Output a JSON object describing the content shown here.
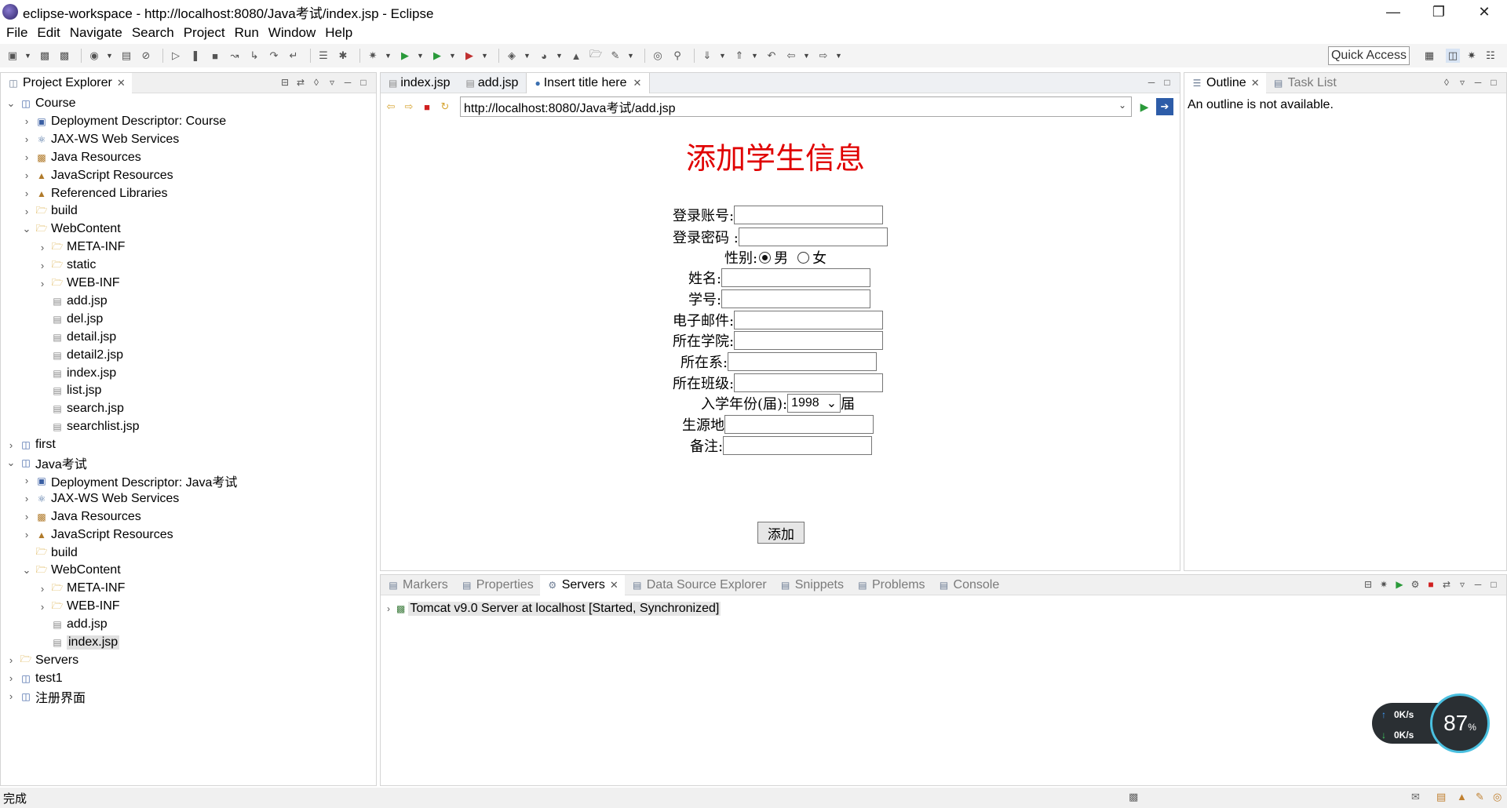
{
  "window": {
    "title": "eclipse-workspace - http://localhost:8080/Java考试/index.jsp - Eclipse"
  },
  "menu": [
    "File",
    "Edit",
    "Navigate",
    "Search",
    "Project",
    "Run",
    "Window",
    "Help"
  ],
  "quick_access": "Quick Access",
  "project_explorer": {
    "tab_label": "Project Explorer",
    "tree": [
      {
        "label": "Course",
        "depth": 0,
        "expanded": true,
        "icon": "project-icon"
      },
      {
        "label": "Deployment Descriptor: Course",
        "depth": 1,
        "expanded": false,
        "icon": "deployment-descriptor-icon"
      },
      {
        "label": "JAX-WS Web Services",
        "depth": 1,
        "expanded": false,
        "icon": "web-services-icon"
      },
      {
        "label": "Java Resources",
        "depth": 1,
        "expanded": false,
        "icon": "java-resources-icon"
      },
      {
        "label": "JavaScript Resources",
        "depth": 1,
        "expanded": false,
        "icon": "javascript-resources-icon"
      },
      {
        "label": "Referenced Libraries",
        "depth": 1,
        "expanded": false,
        "icon": "library-icon"
      },
      {
        "label": "build",
        "depth": 1,
        "expanded": false,
        "icon": "folder-icon"
      },
      {
        "label": "WebContent",
        "depth": 1,
        "expanded": true,
        "icon": "folder-icon"
      },
      {
        "label": "META-INF",
        "depth": 2,
        "expanded": false,
        "icon": "folder-icon"
      },
      {
        "label": "static",
        "depth": 2,
        "expanded": false,
        "icon": "folder-icon"
      },
      {
        "label": "WEB-INF",
        "depth": 2,
        "expanded": false,
        "icon": "folder-icon"
      },
      {
        "label": "add.jsp",
        "depth": 2,
        "leaf": true,
        "icon": "file-icon"
      },
      {
        "label": "del.jsp",
        "depth": 2,
        "leaf": true,
        "icon": "file-icon"
      },
      {
        "label": "detail.jsp",
        "depth": 2,
        "leaf": true,
        "icon": "file-icon"
      },
      {
        "label": "detail2.jsp",
        "depth": 2,
        "leaf": true,
        "icon": "file-icon"
      },
      {
        "label": "index.jsp",
        "depth": 2,
        "leaf": true,
        "icon": "file-icon"
      },
      {
        "label": "list.jsp",
        "depth": 2,
        "leaf": true,
        "icon": "file-icon"
      },
      {
        "label": "search.jsp",
        "depth": 2,
        "leaf": true,
        "icon": "file-icon"
      },
      {
        "label": "searchlist.jsp",
        "depth": 2,
        "leaf": true,
        "icon": "file-icon"
      },
      {
        "label": "first",
        "depth": 0,
        "expanded": false,
        "icon": "project-icon"
      },
      {
        "label": "Java考试",
        "depth": 0,
        "expanded": true,
        "icon": "project-icon"
      },
      {
        "label": "Deployment Descriptor: Java考试",
        "depth": 1,
        "expanded": false,
        "icon": "deployment-descriptor-icon"
      },
      {
        "label": "JAX-WS Web Services",
        "depth": 1,
        "expanded": false,
        "icon": "web-services-icon"
      },
      {
        "label": "Java Resources",
        "depth": 1,
        "expanded": false,
        "icon": "java-resources-icon"
      },
      {
        "label": "JavaScript Resources",
        "depth": 1,
        "expanded": false,
        "icon": "javascript-resources-icon"
      },
      {
        "label": "build",
        "depth": 1,
        "leaf": true,
        "icon": "folder-icon"
      },
      {
        "label": "WebContent",
        "depth": 1,
        "expanded": true,
        "icon": "folder-icon"
      },
      {
        "label": "META-INF",
        "depth": 2,
        "expanded": false,
        "icon": "folder-icon"
      },
      {
        "label": "WEB-INF",
        "depth": 2,
        "expanded": false,
        "icon": "folder-icon"
      },
      {
        "label": "add.jsp",
        "depth": 2,
        "leaf": true,
        "icon": "file-icon"
      },
      {
        "label": "index.jsp",
        "depth": 2,
        "leaf": true,
        "icon": "file-icon",
        "selected": true
      },
      {
        "label": "Servers",
        "depth": 0,
        "expanded": false,
        "icon": "folder-icon"
      },
      {
        "label": "test1",
        "depth": 0,
        "expanded": false,
        "icon": "project-icon"
      },
      {
        "label": "注册界面",
        "depth": 0,
        "expanded": false,
        "icon": "project-icon"
      }
    ]
  },
  "editor": {
    "tabs": [
      {
        "label": "index.jsp",
        "active": false
      },
      {
        "label": "add.jsp",
        "active": false
      },
      {
        "label": "Insert title here",
        "active": true
      }
    ],
    "url": "http://localhost:8080/Java考试/add.jsp"
  },
  "form": {
    "title": "添加学生信息",
    "account_label": "登录账号:",
    "password_label": "登录密码 :",
    "gender_label": "性别:",
    "gender_male": "男",
    "gender_female": "女",
    "gender_selected": "男",
    "name_label": "姓名:",
    "student_id_label": "学号:",
    "email_label": "电子邮件:",
    "college_label": "所在学院:",
    "department_label": "所在系:",
    "class_label": "所在班级:",
    "enroll_year_label": "入学年份(届):",
    "enroll_year_value": "1998",
    "enroll_year_suffix": "届",
    "origin_label": "生源地",
    "remark_label": "备注:",
    "submit_label": "添加"
  },
  "outline": {
    "tabs": [
      {
        "label": "Outline",
        "active": true
      },
      {
        "label": "Task List",
        "active": false
      }
    ],
    "message": "An outline is not available."
  },
  "bottom_panel": {
    "tabs": [
      {
        "label": "Markers",
        "active": false
      },
      {
        "label": "Properties",
        "active": false
      },
      {
        "label": "Servers",
        "active": true
      },
      {
        "label": "Data Source Explorer",
        "active": false
      },
      {
        "label": "Snippets",
        "active": false
      },
      {
        "label": "Problems",
        "active": false
      },
      {
        "label": "Console",
        "active": false
      }
    ],
    "server_entry": "Tomcat v9.0 Server at localhost  [Started, Synchronized]"
  },
  "status_bar": {
    "text": "完成"
  },
  "net_widget": {
    "up": "0K/s",
    "down": "0K/s",
    "percent": "87",
    "percent_unit": "%"
  }
}
